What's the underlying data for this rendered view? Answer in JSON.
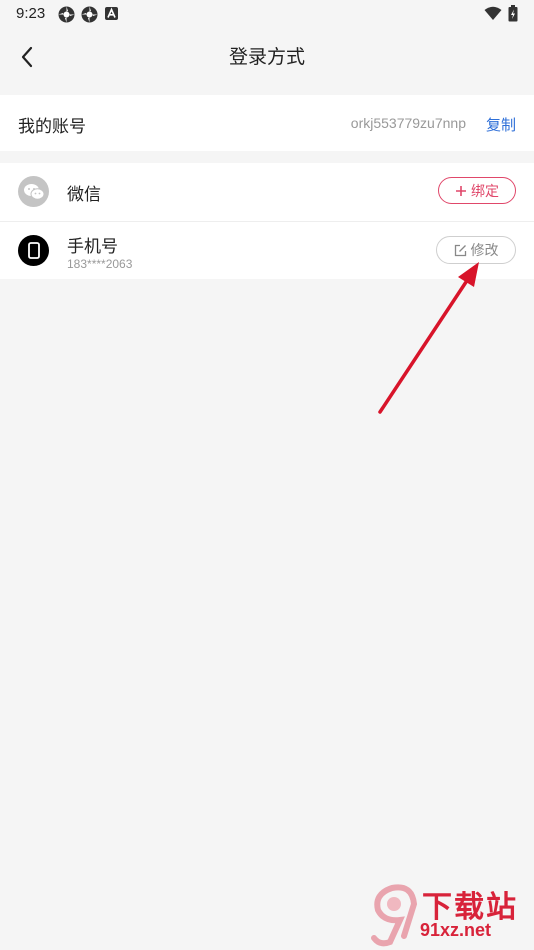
{
  "status_bar": {
    "time": "9:23"
  },
  "header": {
    "title": "登录方式"
  },
  "account": {
    "label": "我的账号",
    "value": "orkj553779zu7nnp",
    "copy_label": "复制"
  },
  "methods": [
    {
      "name": "微信",
      "action_label": "绑定",
      "icon": "wechat-icon"
    },
    {
      "name": "手机号",
      "sub": "183****2063",
      "action_label": "修改",
      "icon": "phone-icon"
    }
  ],
  "watermark": {
    "top": "下载站",
    "bottom": "91xz.net"
  },
  "colors": {
    "accent_pink": "#e0476a",
    "link_blue": "#2e6fd8",
    "arrow_red": "#d8142a"
  }
}
